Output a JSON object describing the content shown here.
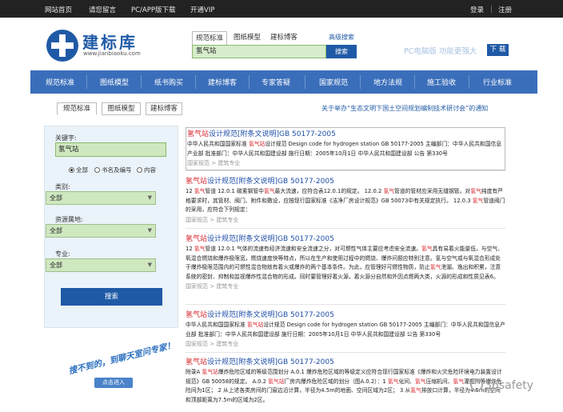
{
  "topbar": {
    "links": [
      "网站首页",
      "请您留言",
      "PC/APP版下载",
      "开通VIP"
    ],
    "login": "登录",
    "register": "注册"
  },
  "header": {
    "logo_name": "建标库",
    "logo_url": "www.jianbiaoku.com",
    "search_tabs": [
      "规范标准",
      "图纸模型",
      "建标博客"
    ],
    "search_value": "氢气站",
    "search_button": "搜索",
    "advanced": "高级搜索",
    "pc_version": "PC电脑版  功能更强大",
    "download": "下 载"
  },
  "nav": [
    "规范标准",
    "图纸模型",
    "纸书购买",
    "建标博客",
    "专家答疑",
    "国家规范",
    "地方法规",
    "施工验收",
    "行业标准"
  ],
  "subtabs": [
    "规范标准",
    "图纸模型",
    "建标博客"
  ],
  "notice": "关于举办“生态文明下国土空间规划编制技术研讨会”的通知",
  "filters": {
    "keyword_label": "关键字:",
    "keyword_value": "氢气站",
    "radios": [
      "全部",
      "书名及编号",
      "内容"
    ],
    "category_label": "类别:",
    "category_value": "全部",
    "region_label": "资源属地:",
    "region_value": "全部",
    "major_label": "专业:",
    "major_value": "全部",
    "search_button": "搜索"
  },
  "banner": {
    "text": "搜不到的，到聊天室问专家！",
    "button": "点击进入"
  },
  "results": [
    {
      "title_pre": "",
      "title_hl": "氢气站",
      "title_post": "设计规范[附条文说明]GB 50177-2005",
      "desc": [
        {
          "t": "中华人民共和国国家标准 "
        },
        {
          "t": "氢气站",
          "hl": true
        },
        {
          "t": "设计规范 Design code for hydrogen station GB 50177-2005 主编部门：中华人民共和国信息产业部 批准部门：中华人民共和国建设部 施行日期：2005年10月1日 中华人民共和国建设部 公告 第330号"
        }
      ],
      "meta": "国家规范 > 建筑专业"
    },
    {
      "title_pre": "",
      "title_hl": "氢气站",
      "title_post": "设计规范[附条文说明]GB 50177-2005",
      "desc": [
        {
          "t": "12 "
        },
        {
          "t": "氢气",
          "hl": true
        },
        {
          "t": "管道 12.0.1 碳素钢管中"
        },
        {
          "t": "氢气",
          "hl": true
        },
        {
          "t": "最大流速，应符合表12.0.1的规定。 12.0.2 "
        },
        {
          "t": "氢气",
          "hl": true
        },
        {
          "t": "管道的管材应采用无缝钢管。对"
        },
        {
          "t": "氢气",
          "hl": true
        },
        {
          "t": "纯度有严格要求时，其管材、阀门、附件和敷设，应按现行国家标准《洁净厂房设计规范》GB 50073中有关规定执行。 12.0.3 "
        },
        {
          "t": "氢气",
          "hl": true
        },
        {
          "t": "管道阀门的采用，应符合下列规定："
        }
      ],
      "meta": "国家规范 > 建筑专业"
    },
    {
      "title_pre": "",
      "title_hl": "氢气站",
      "title_post": "设计规范[附条文说明]GB 50177-2005",
      "desc": [
        {
          "t": "12 "
        },
        {
          "t": "氢气",
          "hl": true
        },
        {
          "t": "管道 12.0.1 气体的流速有经济流速和安全流速之分，对可燃性气体主要应考虑安全流速。"
        },
        {
          "t": "氢气",
          "hl": true
        },
        {
          "t": "具有易着火能量低，与空气、氧混合燃烧和爆炸极限宽，燃烧速度快等特点，所以在生产和使用过程中的燃烧、爆炸问题应特别注意。氢与空气或与氧混合形成处于爆炸极限范围内的可燃性混合物就有着火或爆炸的两个基本条件。为此，应管理好可燃性物质，防止"
        },
        {
          "t": "氢气",
          "hl": true
        },
        {
          "t": "泄漏、逸出和积累，注意系统的密封、抑制和监视爆炸性混合物的形成。同时要管理好着火源，着火源分自然和外因点燃两大类，火源的形成和性质见表6。"
        }
      ],
      "meta": "国家规范 > 建筑专业"
    },
    {
      "title_pre": "",
      "title_hl": "氢气站",
      "title_post": "设计规范[附条文说明]GB 50177-2005",
      "desc": [
        {
          "t": "中华人民共和国国家标准 "
        },
        {
          "t": "氢气站",
          "hl": true
        },
        {
          "t": "设计规范 Design code for hydrogen station GB 50177-2005 主编部门：中华人民共和国信息产业部 批准部门：中华人民共和国建设部 施行日期：2005年10月1日 中华人民共和国建设部 公告 第330号"
        }
      ],
      "meta": "国家规范 > 建筑专业"
    },
    {
      "title_pre": "",
      "title_hl": "氢气站",
      "title_post": "设计规范[附条文说明]GB 50177-2005",
      "desc": [
        {
          "t": "附录A "
        },
        {
          "t": "氢气站",
          "hl": true
        },
        {
          "t": "爆炸危险区域的等级范围划分 A.0.1 爆炸危险区域的等级定义应符合现行国家标准《爆炸和火灾危险环境电力装置设计规范》GB 50058的规定。 A.0.2 "
        },
        {
          "t": "氢气站",
          "hl": true
        },
        {
          "t": "厂房内爆炸危险区域的划分（图A.0.2）：1 "
        },
        {
          "t": "氢气",
          "hl": true
        },
        {
          "t": "化间、"
        },
        {
          "t": "氢气",
          "hl": true
        },
        {
          "t": "压缩机间、"
        },
        {
          "t": "氢气",
          "hl": true
        },
        {
          "t": "灌瓶间等爆炸危险间为1区； 2 从上述各类房间的门窗边沿计算，半径为4.5m的地面、空间区域为2区； 3 从"
        },
        {
          "t": "氢气",
          "hl": true
        },
        {
          "t": "排放口计算，半径为4.5m的空间和顶部距离为7.5m的区域为2区。"
        }
      ],
      "meta": ""
    }
  ],
  "watermark": "36safety"
}
